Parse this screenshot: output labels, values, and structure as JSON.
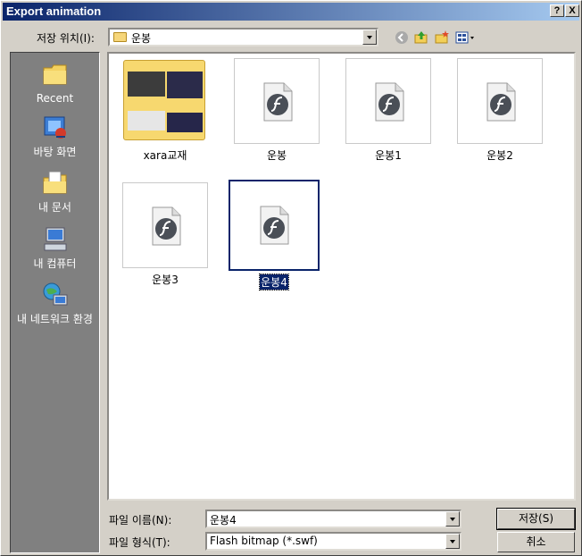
{
  "window": {
    "title": "Export animation",
    "help_btn": "?",
    "close_btn": "X"
  },
  "lookin": {
    "label": "저장 위치(I):",
    "value": "운봉"
  },
  "places": [
    {
      "label": "Recent",
      "icon": "recent-folder-icon"
    },
    {
      "label": "바탕 화면",
      "icon": "desktop-icon"
    },
    {
      "label": "내 문서",
      "icon": "my-documents-icon"
    },
    {
      "label": "내 컴퓨터",
      "icon": "my-computer-icon"
    },
    {
      "label": "내 네트워크 환경",
      "icon": "network-icon"
    }
  ],
  "files": [
    {
      "name": "xara교재",
      "type": "folder"
    },
    {
      "name": "운봉",
      "type": "swf"
    },
    {
      "name": "운봉1",
      "type": "swf"
    },
    {
      "name": "운봉2",
      "type": "swf"
    },
    {
      "name": "운봉3",
      "type": "swf"
    },
    {
      "name": "운봉4",
      "type": "swf",
      "selected": true
    }
  ],
  "filename": {
    "label": "파일 이름(N):",
    "value": "운봉4"
  },
  "filetype": {
    "label": "파일 형식(T):",
    "value": "Flash bitmap (*.swf)"
  },
  "buttons": {
    "save": "저장(S)",
    "cancel": "취소"
  },
  "colors": {
    "title_start": "#0a246a",
    "title_end": "#a6caf0",
    "face": "#d4d0c8",
    "places_bg": "#808080"
  }
}
